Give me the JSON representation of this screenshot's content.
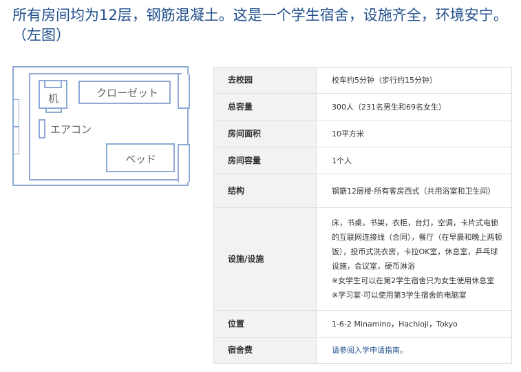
{
  "title": "所有房间均为12层，钢筋混凝土。这是一个学生宿舍，设施齐全，环境安宁。（左图）",
  "plan": {
    "desk": "机",
    "closet": "クローゼット",
    "aircon": "エアコン",
    "bed": "ベッド"
  },
  "rows": [
    {
      "label": "去校园",
      "value": "校车约5分钟（步行约15分钟）"
    },
    {
      "label": "总容量",
      "value": "300人（231名男生和69名女生）"
    },
    {
      "label": "房间面积",
      "value": "10平方米"
    },
    {
      "label": "房间容量",
      "value": "1个人"
    },
    {
      "label": "结构",
      "value": "钢筋12层楼·所有客房西式（共用浴室和卫生间）"
    },
    {
      "label": "设施/设施",
      "value": "床，书桌，书架，衣柜，台灯，空调，卡片式电锁的互联网连接线（合同），餐厅（在早晨和晚上两顿饭），投币式洗衣房，卡拉OK室，休息室，乒乓球设施，会议室，硬币淋浴",
      "notes": [
        "※女学生可以在第2学生宿舍只为女生使用休息室",
        "※学习室·可以使用第3学生宿舍的电脑室"
      ]
    },
    {
      "label": "位置",
      "value": "1-6-2 Minamino，Hachioji，Tokyo"
    },
    {
      "label": "宿舍费",
      "value": "请参阅入学申请指南。"
    }
  ]
}
